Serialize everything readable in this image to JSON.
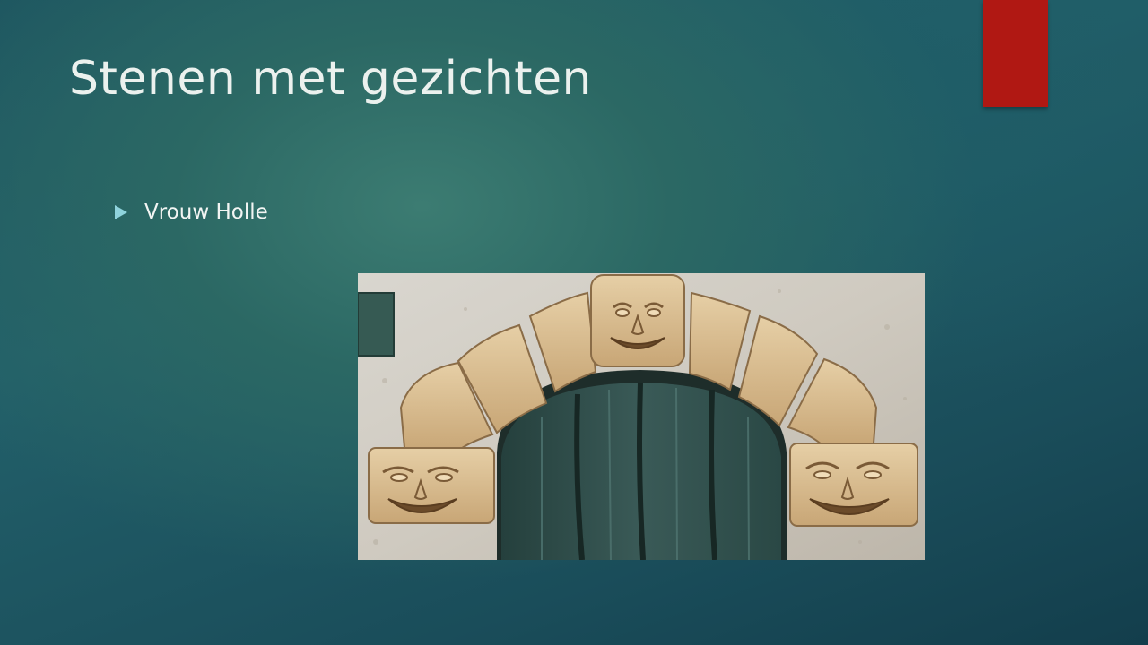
{
  "slide": {
    "title": "Stenen met gezichten",
    "bullets": [
      {
        "text": "Vrouw Holle"
      }
    ]
  },
  "colors": {
    "accent_tab": "#b01813",
    "bullet_icon": "#8fd3dc",
    "title_text": "#ebf1ee"
  },
  "icons": {
    "bullet": "triangle-bullet-icon"
  },
  "image": {
    "subject": "stone-arch-with-carved-faces-photo"
  }
}
